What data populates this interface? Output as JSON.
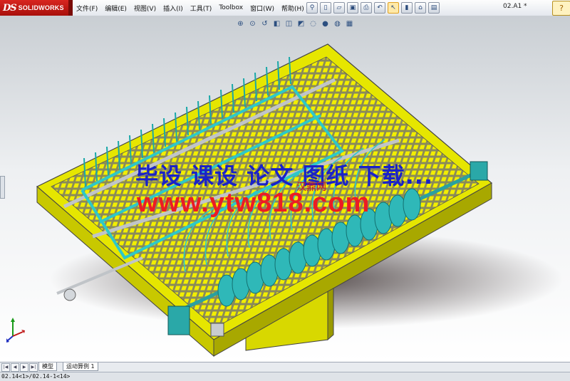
{
  "app": {
    "logo_mark": "DS",
    "logo_word": "SOLIDWORKS",
    "document_title": "02.A1 *"
  },
  "menu": [
    {
      "label": "文件(F)"
    },
    {
      "label": "编辑(E)"
    },
    {
      "label": "视图(V)"
    },
    {
      "label": "插入(I)"
    },
    {
      "label": "工具(T)"
    },
    {
      "label": "Toolbox"
    },
    {
      "label": "窗口(W)"
    },
    {
      "label": "帮助(H)"
    }
  ],
  "toolbar_icons": [
    "pin-icon",
    "new-document-icon",
    "open-icon",
    "save-icon",
    "print-icon",
    "undo-icon",
    "select-arrow-icon",
    "rebuild-icon",
    "file-properties-icon",
    "options-icon"
  ],
  "view_toolbar_icons": [
    "zoom-to-fit-icon",
    "zoom-to-area-icon",
    "previous-view-icon",
    "section-view-icon",
    "view-orientation-icon",
    "display-style-icon",
    "hide-show-items-icon",
    "edit-appearance-icon",
    "apply-scene-icon",
    "view-settings-icon"
  ],
  "watermark": {
    "line1": "毕设 课设 论文 图纸 下载...",
    "small": "汉鼎网",
    "line2": "www.ytw818.com"
  },
  "tabs": [
    {
      "label": "模型"
    },
    {
      "label": "运动算例 1"
    }
  ],
  "status": {
    "text": "02.14<1>/02.14-1<14>"
  },
  "colors": {
    "frame_yellow": "#e6e600",
    "grid_yellow": "#f2ee00",
    "teeth_cyan": "#2ec8c8",
    "watermark_blue": "#1a22c8",
    "watermark_red": "#ec1c24",
    "logo_red": "#c21a14"
  }
}
